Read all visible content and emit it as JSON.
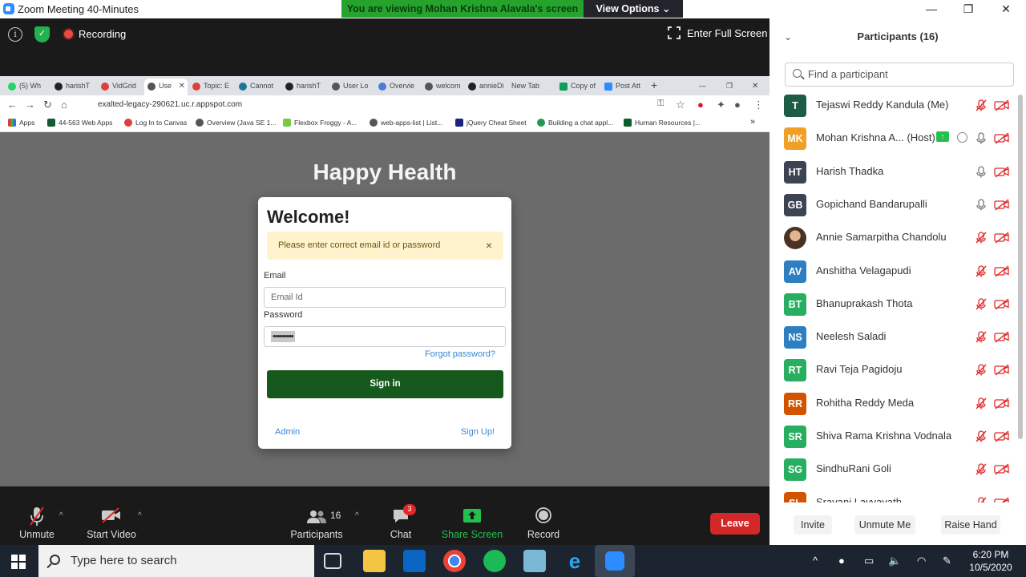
{
  "window": {
    "title": "Zoom Meeting 40-Minutes",
    "minimize": "—",
    "restore": "❐",
    "close": "✕"
  },
  "banner": {
    "viewing_text": "You are viewing Mohan Krishna Alavala's screen",
    "view_options": "View Options ⌄"
  },
  "meeting_top": {
    "recording_label": "Recording",
    "fullscreen_label": "Enter Full Screen"
  },
  "browser": {
    "tabs": [
      {
        "label": "(5) Wh"
      },
      {
        "label": "harishT"
      },
      {
        "label": "VidGrid"
      },
      {
        "label": "Use"
      },
      {
        "label": "Topic: E"
      },
      {
        "label": "Cannot"
      },
      {
        "label": "harishT"
      },
      {
        "label": "User Lo"
      },
      {
        "label": "Overvie"
      },
      {
        "label": "welcom"
      },
      {
        "label": "annieDi"
      },
      {
        "label": "New Tab"
      },
      {
        "label": "Copy of"
      },
      {
        "label": "Post Att"
      }
    ],
    "new_tab": "+",
    "url": "exalted-legacy-290621.uc.r.appspot.com",
    "bookmarks": [
      {
        "label": "Apps"
      },
      {
        "label": "44-563 Web Apps"
      },
      {
        "label": "Log In to Canvas"
      },
      {
        "label": "Overview (Java SE 1..."
      },
      {
        "label": "Flexbox Froggy - A..."
      },
      {
        "label": "web-apps-list | List..."
      },
      {
        "label": "jQuery Cheat Sheet"
      },
      {
        "label": "Building a chat appl..."
      },
      {
        "label": "Human Resources |..."
      }
    ],
    "more": "»"
  },
  "page": {
    "title": "Happy Health",
    "card": {
      "heading": "Welcome!",
      "alert": "Please enter correct email id or password",
      "alert_close": "×",
      "email_label": "Email",
      "email_placeholder": "Email Id",
      "password_label": "Password",
      "password_value": "•••••••••",
      "forgot": "Forgot password?",
      "signin": "Sign in",
      "admin": "Admin",
      "signup": "Sign Up!"
    }
  },
  "toolbar": {
    "unmute": "Unmute",
    "start_video": "Start Video",
    "participants": "Participants",
    "participants_count": "16",
    "chat": "Chat",
    "chat_badge": "3",
    "share_screen": "Share Screen",
    "record": "Record",
    "leave": "Leave"
  },
  "panel": {
    "title": "Participants (16)",
    "search_placeholder": "Find a participant",
    "participants": [
      {
        "initials": "T",
        "name": "Tejaswi Reddy Kandula (Me)",
        "color": "#1f5c45",
        "mic": "muted"
      },
      {
        "initials": "MK",
        "name": "Mohan Krishna A... (Host)",
        "color": "#f0a024",
        "mic": "on"
      },
      {
        "initials": "HT",
        "name": "Harish Thadka",
        "color": "#3d4451",
        "mic": "on"
      },
      {
        "initials": "GB",
        "name": "Gopichand Bandarupalli",
        "color": "#3d4451",
        "mic": "on"
      },
      {
        "initials": "",
        "name": "Annie Samarpitha Chandolu",
        "color": "#8a6a4e",
        "mic": "muted"
      },
      {
        "initials": "AV",
        "name": "Anshitha Velagapudi",
        "color": "#2e7fc2",
        "mic": "muted"
      },
      {
        "initials": "BT",
        "name": "Bhanuprakash Thota",
        "color": "#27ae60",
        "mic": "muted"
      },
      {
        "initials": "NS",
        "name": "Neelesh Saladi",
        "color": "#2e7fc2",
        "mic": "muted"
      },
      {
        "initials": "RT",
        "name": "Ravi Teja Pagidoju",
        "color": "#27ae60",
        "mic": "muted"
      },
      {
        "initials": "RR",
        "name": "Rohitha Reddy Meda",
        "color": "#d35400",
        "mic": "muted"
      },
      {
        "initials": "SR",
        "name": "Shiva Rama Krishna Vodnala",
        "color": "#27ae60",
        "mic": "muted"
      },
      {
        "initials": "SG",
        "name": "SindhuRani Goli",
        "color": "#27ae60",
        "mic": "muted"
      },
      {
        "initials": "SL",
        "name": "Sravani Lavvavath",
        "color": "#d35400",
        "mic": "muted"
      }
    ],
    "invite": "Invite",
    "unmute_me": "Unmute Me",
    "raise_hand": "Raise Hand"
  },
  "taskbar": {
    "search_placeholder": "Type here to search",
    "time": "6:20 PM",
    "date": "10/5/2020"
  }
}
